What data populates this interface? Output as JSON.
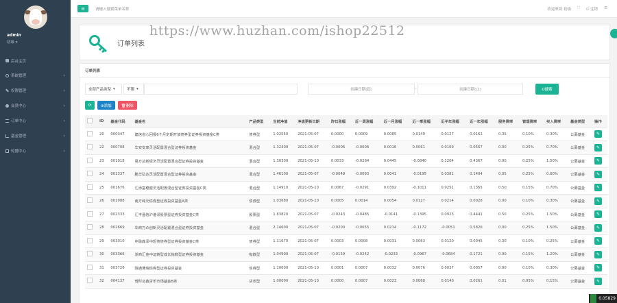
{
  "sidebar": {
    "profile": {
      "name": "admin",
      "role": "初级 ▾"
    },
    "items": [
      {
        "label": "后台主页",
        "arrow": ""
      },
      {
        "label": "系统管理",
        "arrow": "›"
      },
      {
        "label": "权限管理",
        "arrow": "›"
      },
      {
        "label": "会员中心",
        "arrow": "›"
      },
      {
        "label": "订单中心",
        "arrow": "›"
      },
      {
        "label": "基金管理",
        "arrow": "›"
      },
      {
        "label": "轮播中心",
        "arrow": "›"
      }
    ]
  },
  "topbar": {
    "menu_icon": "≡",
    "search_hint": "请输入搜索菜单名称",
    "welcome": "欢迎来到 初级",
    "logout_label": "注销",
    "icons": [
      "expand-icon",
      "power-icon",
      "menu-icon"
    ]
  },
  "header": {
    "title": "订单列表"
  },
  "watermark": "https://www.huzhan.com/ishop22512",
  "panel": {
    "title": "订单列表",
    "filters": {
      "product_type": "全部产品类型",
      "select2": "不限",
      "start_date": "创建日期(起)",
      "separator": "-",
      "end_date": "创建日期(止)",
      "search_label": "Q搜索"
    },
    "toolbar": {
      "refresh_icon": "⟳",
      "add_label": "⊕添加",
      "delete_label": "🗑删除"
    }
  },
  "table": {
    "headers": [
      "ID",
      "基金代码",
      "基金名",
      "产品类型",
      "当前净值",
      "净值更新日期",
      "昨日涨幅",
      "近一周涨幅",
      "近一月涨幅",
      "近一季涨幅",
      "近半年涨幅",
      "近一年涨幅",
      "服务费率",
      "管理费率",
      "买入费率",
      "基金类型",
      "操作"
    ],
    "rows": [
      [
        "20",
        "000347",
        "建信省心回报6个月定期开放债券型证券投资基金C类",
        "债券型",
        "1.02550",
        "2021-05-07",
        "0.0000",
        "0.0009",
        "0.0085",
        "0.0149",
        "0.0127",
        "0.0161",
        "0.35",
        "0.10%",
        "0.30%",
        "公募基金"
      ],
      [
        "22",
        "000708",
        "华安安享灵活配置混合型证券投资基金",
        "混合型",
        "1.32300",
        "2021-05-07",
        "-0.0006",
        "-0.0006",
        "0.0016",
        "0.0061",
        "0.0169",
        "0.0567",
        "0.00",
        "0.25%",
        "0.70%",
        "公募基金"
      ],
      [
        "23",
        "001018",
        "易方达新经济灵活配置混合型证券投资基金",
        "混合型",
        "1.30300",
        "2021-05-10",
        "0.0033",
        "-0.0264",
        "0.0445",
        "-0.0840",
        "0.1204",
        "0.4367",
        "0.00",
        "0.25%",
        "1.50%",
        "公募基金"
      ],
      [
        "24",
        "001337",
        "鹏华弘达灵活配置混合型证券投资基金",
        "混合型",
        "1.46100",
        "2021-05-07",
        "-0.0048",
        "-0.0093",
        "0.0041",
        "-0.0195",
        "0.0381",
        "0.1404",
        "0.05",
        "0.25%",
        "0.60%",
        "公募基金"
      ],
      [
        "25",
        "001676",
        "汇添富稳健灵活配置混合型证券投资基金C类",
        "混合型",
        "1.14910",
        "2021-05-10",
        "0.0067",
        "-0.0291",
        "0.0392",
        "-0.1011",
        "0.0251",
        "0.1365",
        "0.50",
        "0.15%",
        "0.70%",
        "公募基金"
      ],
      [
        "26",
        "001988",
        "南方纯元债券型证券投资基金A类",
        "债券型",
        "1.03680",
        "2021-05-10",
        "0.0005",
        "0.0014",
        "0.0054",
        "0.0127",
        "0.0214",
        "0.0028",
        "0.00",
        "0.10%",
        "0.30%",
        "公募基金"
      ],
      [
        "27",
        "002333",
        "汇丰晋信沪港深股票型证券投资基金C类",
        "股票型",
        "1.83820",
        "2021-05-07",
        "-0.0243",
        "-0.0485",
        "-0.0141",
        "-0.1395",
        "0.0923",
        "0.4441",
        "0.50",
        "0.25%",
        "1.50%",
        "公募基金"
      ],
      [
        "28",
        "002669",
        "华商万众创新灵活配置混合型证券投资基金",
        "混合型",
        "2.14600",
        "2021-05-07",
        "-0.0200",
        "-0.0055",
        "0.0214",
        "-0.1172",
        "-0.0051",
        "0.5826",
        "0.00",
        "0.25%",
        "1.50%",
        "公募基金"
      ],
      [
        "29",
        "003010",
        "中融鑫泽中短债债券型证券投资基金C类",
        "债券型",
        "1.11670",
        "2021-05-07",
        "0.0003",
        "0.0008",
        "0.0031",
        "0.0063",
        "0.0120",
        "0.0045",
        "0.30",
        "0.10%",
        "0.25%",
        "公募基金"
      ],
      [
        "30",
        "003366",
        "浙商汇金中证转型成长指数型证券投资基金",
        "指数型",
        "1.04900",
        "2021-05-07",
        "-0.0159",
        "-0.0242",
        "-0.0233",
        "-0.0967",
        "-0.0684",
        "0.1721",
        "0.00",
        "0.15%",
        "1.20%",
        "公募基金"
      ],
      [
        "31",
        "003726",
        "融通通瑞债券型证券投资基金",
        "债券型",
        "1.10000",
        "2021-05-10",
        "0.0001",
        "0.0007",
        "0.0032",
        "0.0076",
        "0.0037",
        "0.0057",
        "0.00",
        "0.10%",
        "0.30%",
        "公募基金"
      ],
      [
        "32",
        "004137",
        "博时合鑫货币市场基金B类",
        "货币型",
        "1.00000",
        "2021-05-10",
        "0.0000",
        "0.0007",
        "0.0023",
        "0.0068",
        "0.0140",
        "0.0261",
        "0.01",
        "0.05%",
        "0.15%",
        "公募基金"
      ]
    ]
  },
  "badge": "0.05829"
}
